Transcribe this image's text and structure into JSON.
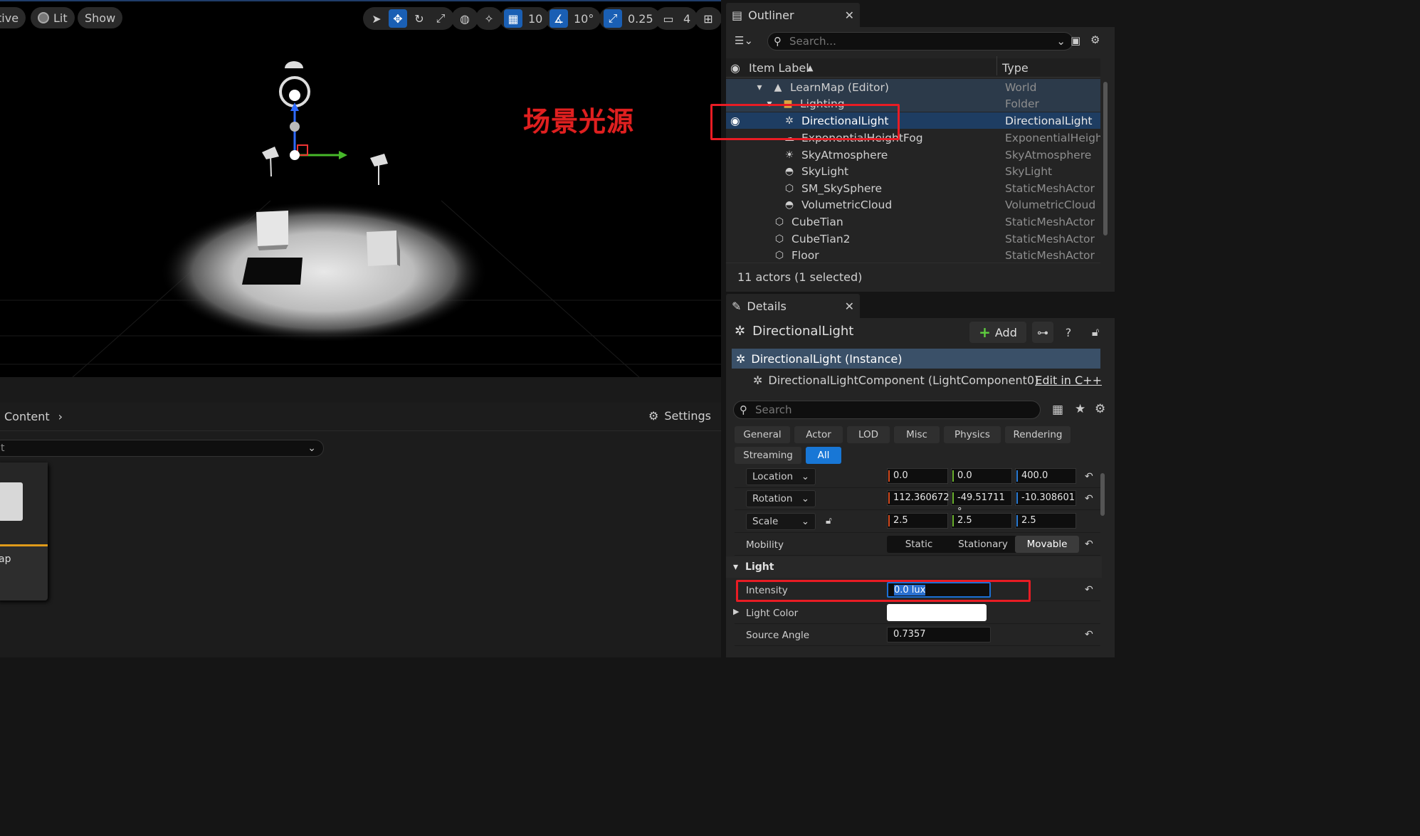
{
  "viewport": {
    "mode_label": "tive",
    "lit_label": "Lit",
    "show_label": "Show",
    "grid_snap": "10",
    "rotation_snap": "10°",
    "scale_snap": "0.25",
    "camera_speed": "4",
    "caption": "场景光源"
  },
  "content_browser": {
    "crumb": "Content",
    "settings_label": "Settings",
    "filter_text": "t",
    "asset_label": "ap"
  },
  "outliner": {
    "tab_title": "Outliner",
    "search_placeholder": "Search...",
    "col_label": "Item Label",
    "col_type": "Type",
    "rows": [
      {
        "label": "LearnMap (Editor)",
        "type": "World"
      },
      {
        "label": "Lighting",
        "type": "Folder"
      },
      {
        "label": "DirectionalLight",
        "type": "DirectionalLight"
      },
      {
        "label": "ExponentialHeightFog",
        "type": "ExponentialHeightF"
      },
      {
        "label": "SkyAtmosphere",
        "type": "SkyAtmosphere"
      },
      {
        "label": "SkyLight",
        "type": "SkyLight"
      },
      {
        "label": "SM_SkySphere",
        "type": "StaticMeshActor"
      },
      {
        "label": "VolumetricCloud",
        "type": "VolumetricCloud"
      },
      {
        "label": "CubeTian",
        "type": "StaticMeshActor"
      },
      {
        "label": "CubeTian2",
        "type": "StaticMeshActor"
      },
      {
        "label": "Floor",
        "type": "StaticMeshActor"
      }
    ],
    "footer": "11 actors (1 selected)"
  },
  "details": {
    "tab_title": "Details",
    "object_name": "DirectionalLight",
    "add_label": "Add",
    "instance_label": "DirectionalLight (Instance)",
    "component_label": "DirectionalLightComponent (LightComponent0)",
    "edit_cpp": "Edit in C++",
    "search_placeholder": "Search",
    "categories": [
      "General",
      "Actor",
      "LOD",
      "Misc",
      "Physics",
      "Rendering",
      "Streaming",
      "All"
    ],
    "location_label": "Location",
    "location": [
      "0.0",
      "0.0",
      "400.0"
    ],
    "rotation_label": "Rotation",
    "rotation": [
      "112.360672",
      "-49.51711 °",
      "-10.308601"
    ],
    "scale_label": "Scale",
    "scale": [
      "2.5",
      "2.5",
      "2.5"
    ],
    "mobility_label": "Mobility",
    "mobility_options": [
      "Static",
      "Stationary",
      "Movable"
    ],
    "light_section": "Light",
    "intensity_label": "Intensity",
    "intensity_value": "0.0 lux",
    "light_color_label": "Light Color",
    "source_angle_label": "Source Angle",
    "source_angle_value": "0.7357"
  },
  "colors": {
    "accent": "#1877d6",
    "selection": "#1e3d62",
    "annotation_red": "#e81c24"
  }
}
